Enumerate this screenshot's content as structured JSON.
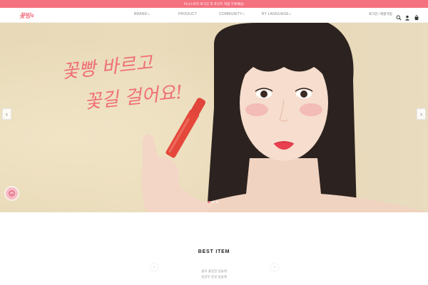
{
  "announcement": {
    "text": "이니스프리 로그인 후 포인트 적립 무료배송!"
  },
  "header": {
    "logo_text": "꽃빙",
    "nav": [
      {
        "label": "BRAND",
        "caret": "▾"
      },
      {
        "label": "PRODUCT",
        "caret": ""
      },
      {
        "label": "COMMUNITY",
        "caret": "▾"
      },
      {
        "label": "BY LANGUAGE",
        "caret": "▾"
      }
    ],
    "member_links": "로그인 / 회원가입",
    "icons": [
      "search-icon",
      "user-icon",
      "cart-icon"
    ]
  },
  "hero": {
    "headline_line1": "꽃빵 바르고",
    "headline_line2": "꽃길 걸어요!",
    "prev_label": "‹",
    "next_label": "›",
    "slide_count": 3,
    "active_slide": 1
  },
  "chat": {
    "icon": "chat-icon"
  },
  "best": {
    "title": "BEST ITEM",
    "prev_label": "‹",
    "next_label": "›",
    "line1": "꽃이 꽃잎일 입술에",
    "line2": "몽글이 몽실 입술에"
  },
  "colors": {
    "accent": "#f06d7d",
    "announcement_bg": "#f4717f",
    "hero_bg": "#e8dab8"
  }
}
